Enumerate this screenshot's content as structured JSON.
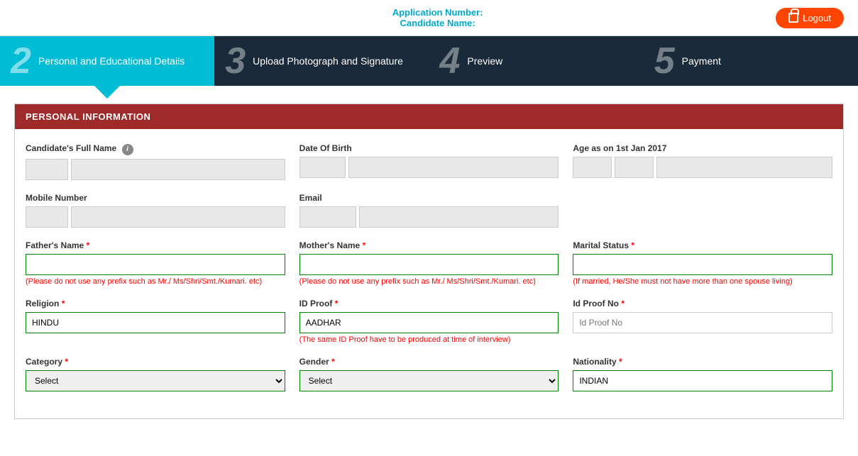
{
  "header": {
    "application_number_label": "Application Number:",
    "candidate_name_label": "Candidate Name:",
    "logout_label": "Logout"
  },
  "steps": [
    {
      "number": "2",
      "label": "Personal and Educational Details",
      "active": true
    },
    {
      "number": "3",
      "label": "Upload Photograph and Signature",
      "active": false
    },
    {
      "number": "4",
      "label": "Preview",
      "active": false
    },
    {
      "number": "5",
      "label": "Payment",
      "active": false
    }
  ],
  "personal_info": {
    "section_title": "PERSONAL INFORMATION",
    "fields": {
      "full_name_label": "Candidate's Full Name",
      "dob_label": "Date Of Birth",
      "age_label": "Age as on 1st Jan 2017",
      "mobile_label": "Mobile Number",
      "email_label": "Email",
      "father_name_label": "Father's Name",
      "father_hint": "(Please do not use any prefix such as Mr./ Ms/Shri/Smt./Kumari. etc)",
      "mother_name_label": "Mother's Name",
      "mother_hint": "(Please do not use any prefix such as Mr./ Ms/Shri/Smt./Kumari. etc)",
      "marital_status_label": "Marital Status",
      "marital_hint": "(If married, He/She must not have more than one spouse living)",
      "religion_label": "Religion",
      "religion_value": "HINDU",
      "id_proof_label": "ID Proof",
      "id_proof_value": "AADHAR",
      "id_proof_note": "(The same ID Proof have to be produced at time of interview)",
      "id_proof_no_label": "Id Proof No",
      "id_proof_no_placeholder": "Id Proof No",
      "category_label": "Category",
      "category_placeholder": "Select",
      "gender_label": "Gender",
      "gender_placeholder": "Select",
      "nationality_label": "Nationality",
      "nationality_value": "INDIAN"
    }
  }
}
